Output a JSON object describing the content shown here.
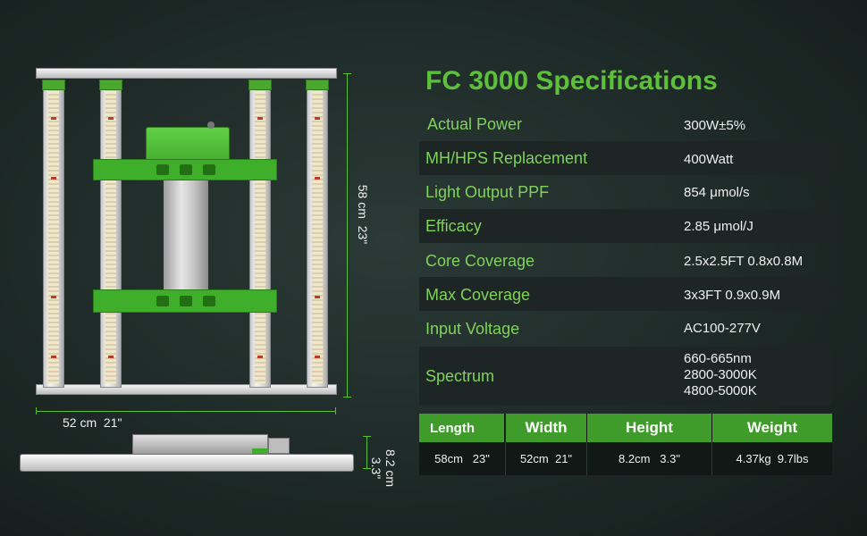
{
  "title": "FC 3000 Specifications",
  "specs": [
    {
      "label": "Actual Power",
      "value": "300W±5%"
    },
    {
      "label": "MH/HPS Replacement",
      "value": "400Watt"
    },
    {
      "label": "Light Output PPF",
      "value": "854 μmol/s"
    },
    {
      "label": "Efficacy",
      "value": "2.85  μmol/J"
    },
    {
      "label": "Core Coverage",
      "value": "2.5x2.5FT 0.8x0.8M"
    },
    {
      "label": "Max Coverage",
      "value": "3x3FT 0.9x0.9M"
    },
    {
      "label": "Input Voltage",
      "value": "AC100-277V"
    },
    {
      "label": "Spectrum",
      "value_lines": [
        "660-665nm",
        "2800-3000K",
        "4800-5000K"
      ]
    }
  ],
  "dimensions_table": {
    "headers": [
      "Length",
      "Width",
      "Height",
      "Weight"
    ],
    "values": [
      "58cm   23\"",
      "52cm  21\"",
      "8.2cm   3.3\"",
      "4.37kg  9.7lbs"
    ]
  },
  "dimension_labels": {
    "height_cm": "58 cm",
    "height_in": "23\"",
    "width_cm": "52 cm",
    "width_in": "21\"",
    "depth_cm": "8.2 cm",
    "depth_in": "3.3\""
  },
  "colors": {
    "accent_green": "#5dbf3a",
    "label_green": "#7fd35a",
    "header_green": "#3f9c2a",
    "background": "#1e2a27"
  }
}
